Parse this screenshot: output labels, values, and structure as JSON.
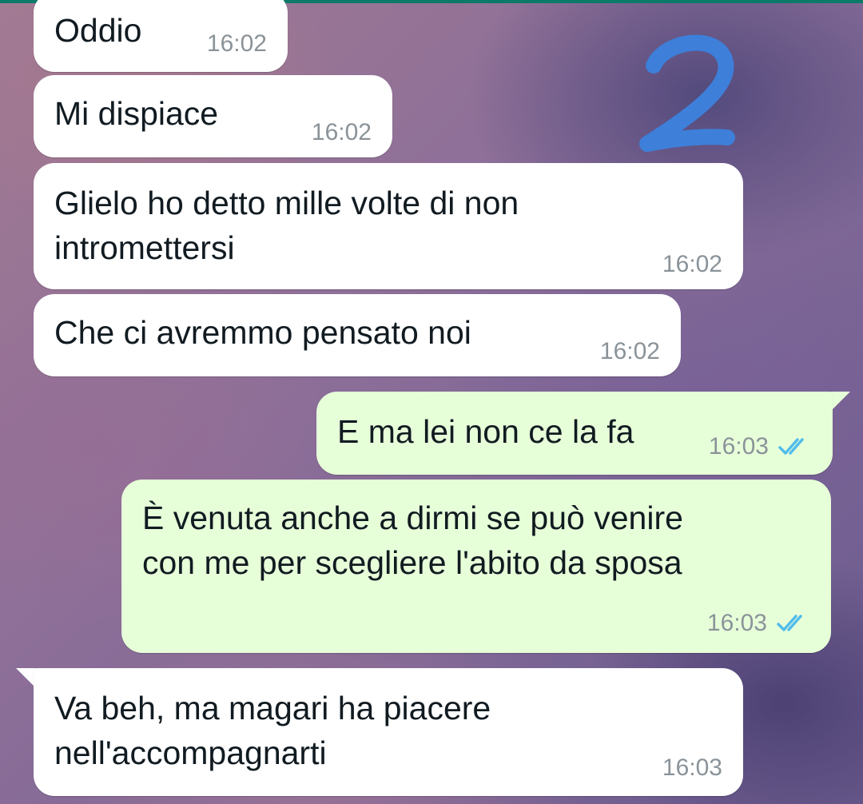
{
  "annotation_text": "2",
  "messages": [
    {
      "direction": "incoming",
      "text": "Oddio",
      "time": "16:02"
    },
    {
      "direction": "incoming",
      "text": "Mi dispiace",
      "time": "16:02"
    },
    {
      "direction": "incoming",
      "text": "Glielo ho detto mille volte di non\nintromettersi",
      "time": "16:02"
    },
    {
      "direction": "incoming",
      "text": "Che ci avremmo pensato noi",
      "time": "16:02"
    },
    {
      "direction": "outgoing",
      "text": "E ma lei non ce la fa",
      "time": "16:03",
      "status": "read"
    },
    {
      "direction": "outgoing",
      "text": "È venuta anche a dirmi se può venire\ncon me per scegliere l'abito da sposa",
      "time": "16:03",
      "status": "read"
    },
    {
      "direction": "incoming",
      "text": "Va beh, ma magari ha piacere\nnell'accompagnarti",
      "time": "16:03"
    }
  ],
  "colors": {
    "incoming_bubble": "#ffffff",
    "outgoing_bubble": "#e7ffd9",
    "read_ticks": "#53bdeb",
    "annotation": "#3d7fd9",
    "header_strip": "#0c7a69"
  },
  "icons": {
    "read_receipt": "double-check-icon"
  }
}
